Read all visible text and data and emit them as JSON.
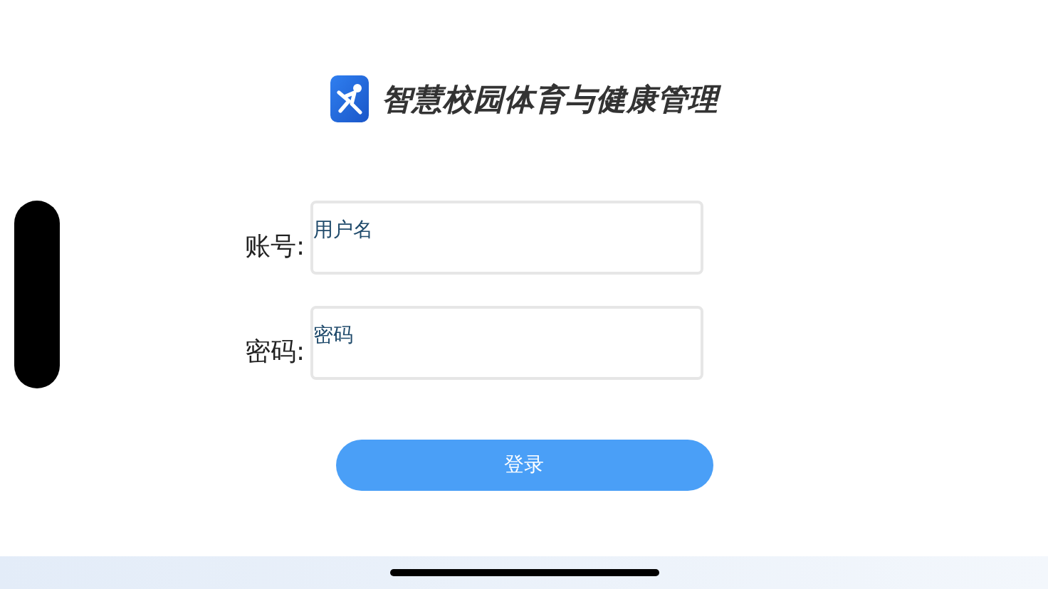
{
  "header": {
    "title": "智慧校园体育与健康管理"
  },
  "fields": [
    {
      "label": "账号:",
      "placeholder": "用户名"
    },
    {
      "label": "密码:",
      "placeholder": "密码"
    }
  ],
  "login_button": {
    "label": "登录"
  }
}
